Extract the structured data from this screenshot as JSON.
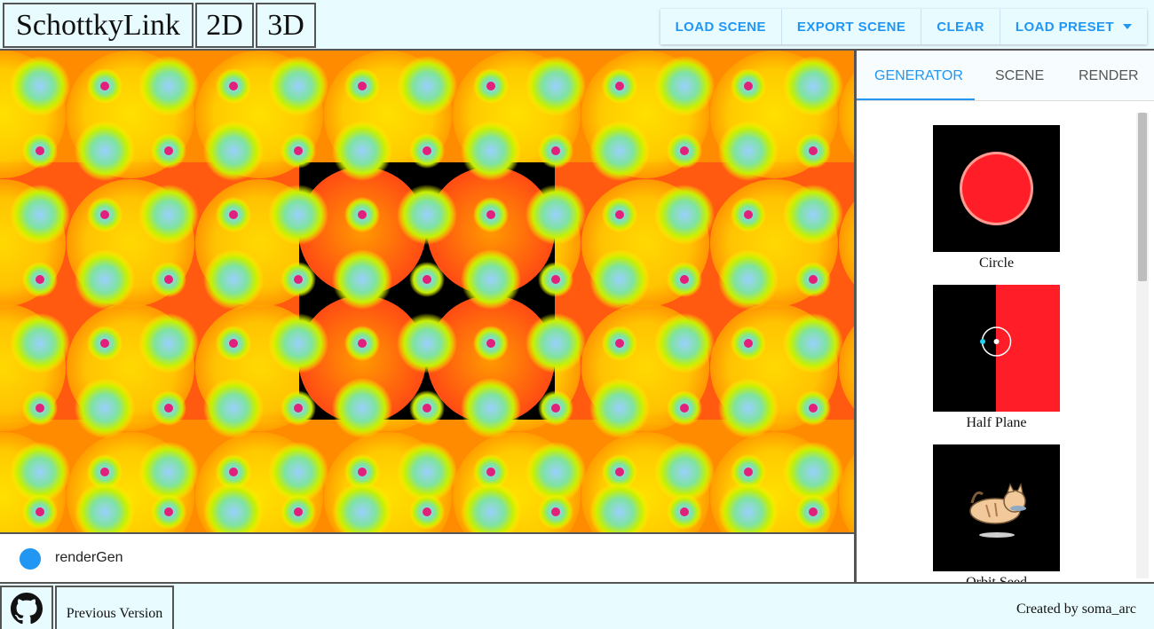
{
  "header": {
    "title": "SchottkyLink",
    "mode_2d": "2D",
    "mode_3d": "3D",
    "buttons": {
      "load_scene": "LOAD SCENE",
      "export_scene": "EXPORT SCENE",
      "clear": "CLEAR",
      "load_preset": "LOAD PRESET"
    }
  },
  "status": {
    "label": "renderGen",
    "dot_color": "#2196f3"
  },
  "panel": {
    "tabs": [
      "GENERATOR",
      "SCENE",
      "RENDER"
    ],
    "active_tab": "GENERATOR",
    "generators": [
      {
        "label": "Circle",
        "icon": "circle-thumb"
      },
      {
        "label": "Half Plane",
        "icon": "half-plane-thumb"
      },
      {
        "label": "Orbit Seed",
        "icon": "cat-thumb"
      }
    ]
  },
  "footer": {
    "github_icon": "github-icon",
    "previous_version": "Previous Version",
    "credit": "Created by soma_arc"
  },
  "colors": {
    "accent": "#2196f3",
    "fractal_red": "#ff4b14",
    "fractal_orange": "#ff8c00",
    "fractal_yellow": "#ffff00"
  }
}
